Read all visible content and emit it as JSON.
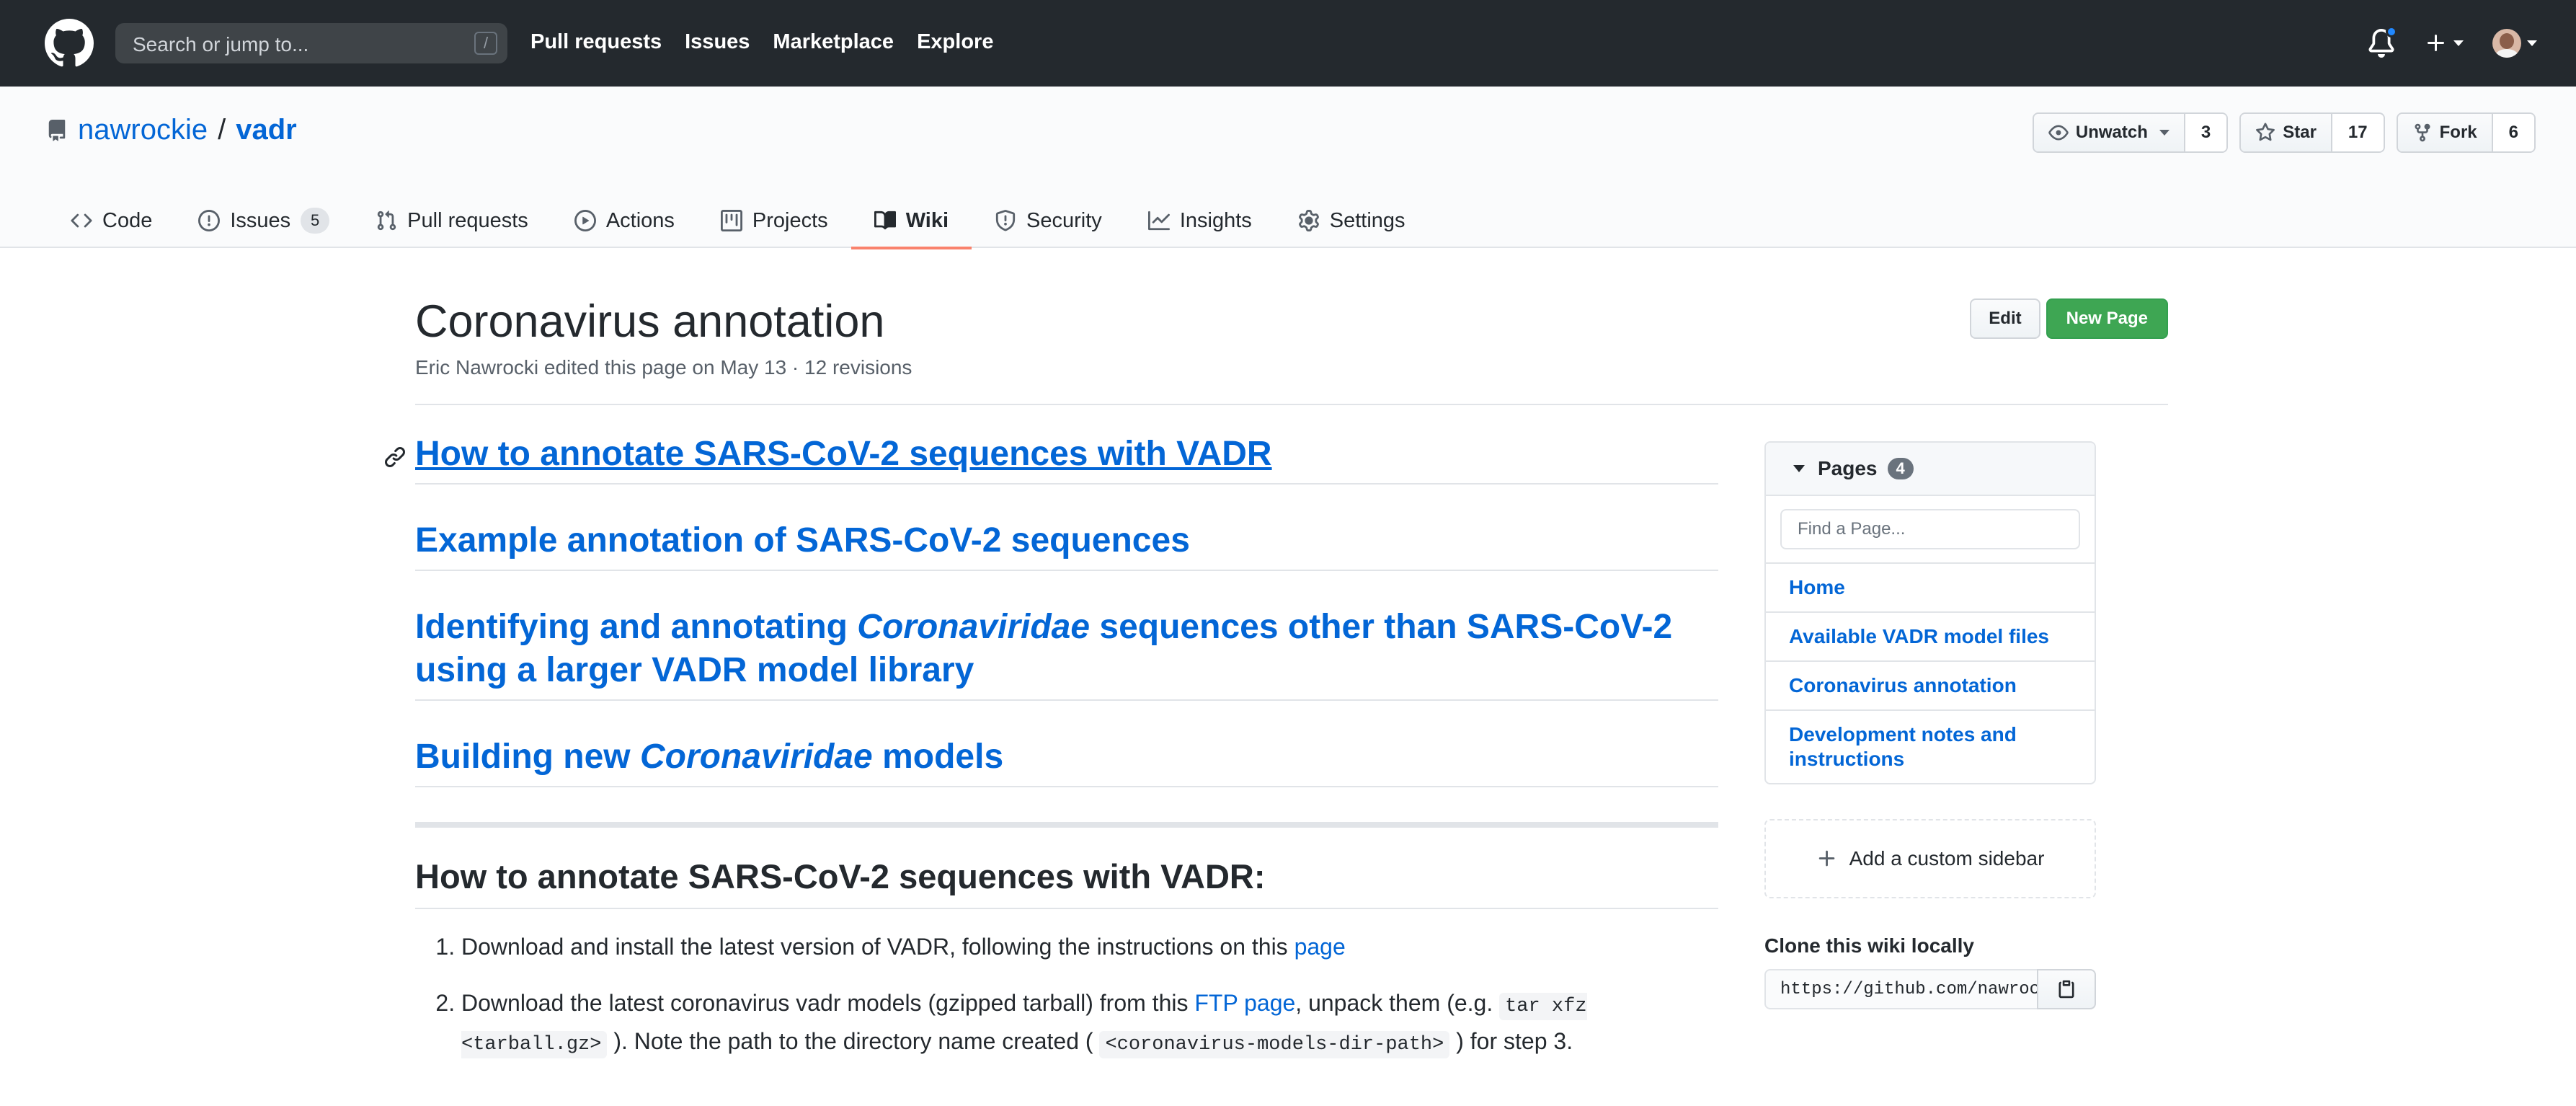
{
  "header": {
    "search_placeholder": "Search or jump to...",
    "search_shortcut": "/",
    "nav": [
      "Pull requests",
      "Issues",
      "Marketplace",
      "Explore"
    ]
  },
  "repo": {
    "owner": "nawrockie",
    "separator": "/",
    "name": "vadr",
    "unwatch_label": "Unwatch",
    "watch_count": "3",
    "star_label": "Star",
    "star_count": "17",
    "fork_label": "Fork",
    "fork_count": "6",
    "tabs": [
      {
        "label": "Code",
        "icon": "code-icon"
      },
      {
        "label": "Issues",
        "icon": "issue-icon",
        "count": "5"
      },
      {
        "label": "Pull requests",
        "icon": "pull-request-icon"
      },
      {
        "label": "Actions",
        "icon": "play-icon"
      },
      {
        "label": "Projects",
        "icon": "project-icon"
      },
      {
        "label": "Wiki",
        "icon": "book-icon",
        "selected": true
      },
      {
        "label": "Security",
        "icon": "shield-icon"
      },
      {
        "label": "Insights",
        "icon": "graph-icon"
      },
      {
        "label": "Settings",
        "icon": "gear-icon"
      }
    ]
  },
  "page": {
    "title": "Coronavirus annotation",
    "meta": "Eric Nawrocki edited this page on May 13 · 12 revisions",
    "edit_label": "Edit",
    "new_page_label": "New Page"
  },
  "toc": {
    "h1": "How to annotate SARS-CoV-2 sequences with VADR",
    "h2": "Example annotation of SARS-CoV-2 sequences",
    "h3_pre": "Identifying and annotating ",
    "h3_em": "Coronaviridae",
    "h3_post": " sequences other than SARS-CoV-2 using a larger VADR model library",
    "h4_pre": "Building new ",
    "h4_em": "Coronaviridae",
    "h4_post": " models"
  },
  "section": {
    "heading": "How to annotate SARS-CoV-2 sequences with VADR:",
    "step1_text": "Download and install the latest version of VADR, following the instructions on this ",
    "step1_link": "page",
    "step2_a": "Download the latest coronavirus vadr models (gzipped tarball) from this ",
    "step2_link": "FTP page",
    "step2_b": ", unpack them (e.g. ",
    "step2_code1": "tar xfz <tarball.gz>",
    "step2_c": " ). Note the path to the directory name created ( ",
    "step2_code2": "<coronavirus-models-dir-path>",
    "step2_d": " ) for step 3."
  },
  "sidebar": {
    "pages_label": "Pages",
    "pages_count": "4",
    "find_placeholder": "Find a Page...",
    "pages": [
      "Home",
      "Available VADR model files",
      "Coronavirus annotation",
      "Development notes and instructions"
    ],
    "custom_sidebar_label": "Add a custom sidebar",
    "clone_label": "Clone this wiki locally",
    "clone_url": "https://github.com/nawrockie/vadr.wiki.git"
  },
  "colors": {
    "header_bg": "#24292e",
    "link": "#0366d6",
    "tab_underline": "#f9826c",
    "new_page_btn": "#3ea653"
  }
}
